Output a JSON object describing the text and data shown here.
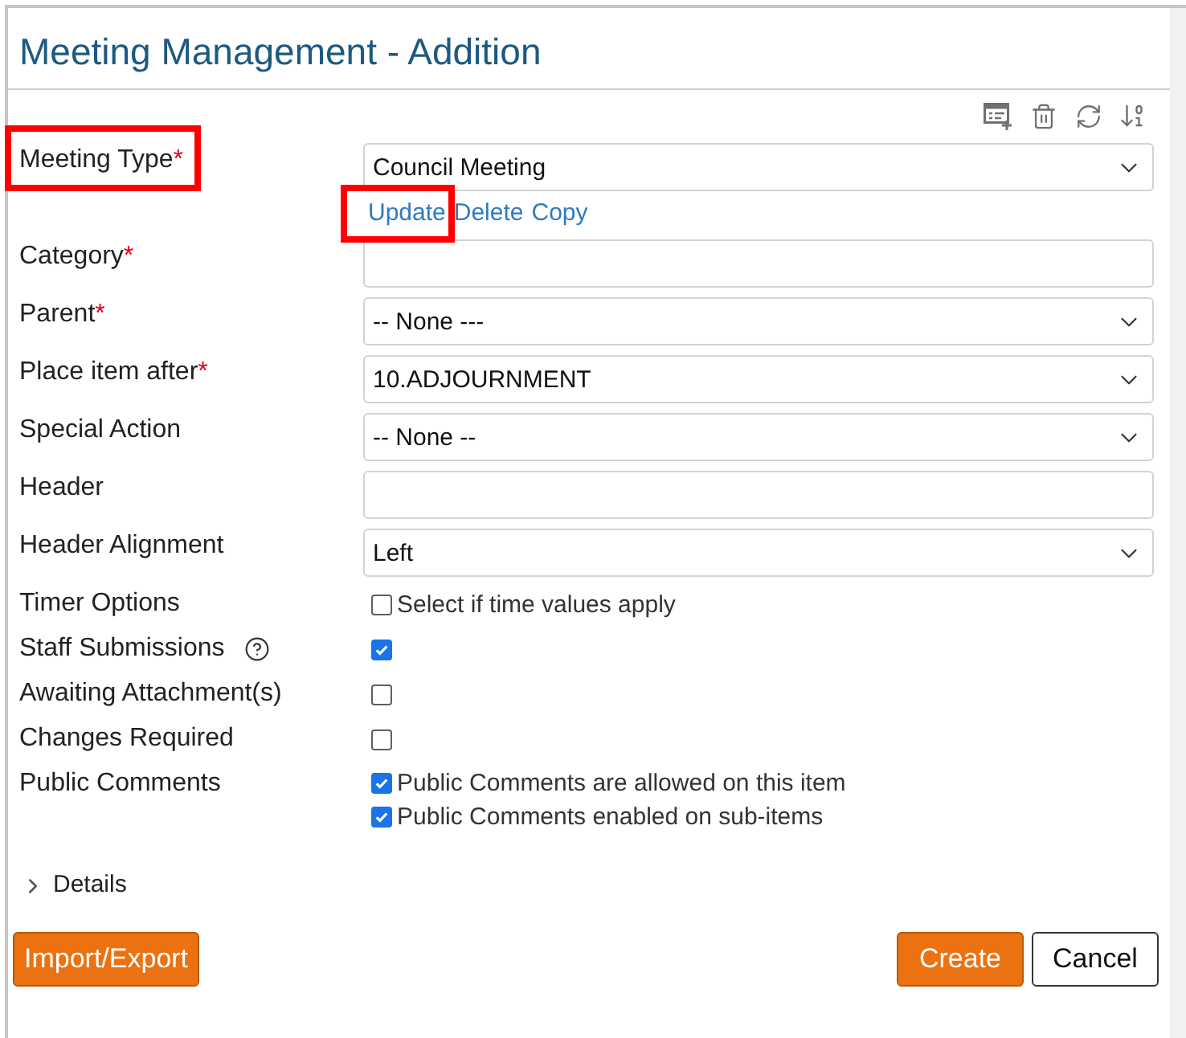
{
  "title": "Meeting Management - Addition",
  "fields": [
    {
      "kind": "select",
      "label": "Meeting Type",
      "required_mark": "*",
      "help": false,
      "highlighted": true,
      "value": "Council Meeting",
      "links": [
        {
          "label": "Update",
          "highlighted": true
        },
        {
          "label": "Delete",
          "highlighted": false
        },
        {
          "label": "Copy",
          "highlighted": false
        }
      ]
    },
    {
      "kind": "text",
      "label": "Category",
      "required_mark": "*",
      "help": false,
      "highlighted": false
    },
    {
      "kind": "select",
      "label": "Parent",
      "required_mark": "*",
      "help": false,
      "highlighted": false,
      "value": "-- None ---"
    },
    {
      "kind": "select",
      "label": "Place item after",
      "required_mark": "*",
      "help": false,
      "highlighted": false,
      "value": "10.ADJOURNMENT"
    },
    {
      "kind": "select",
      "label": "Special Action",
      "help": false,
      "highlighted": false,
      "value": "-- None --"
    },
    {
      "kind": "text",
      "label": "Header",
      "help": false,
      "highlighted": false
    },
    {
      "kind": "select",
      "label": "Header Alignment",
      "help": false,
      "highlighted": false,
      "value": "Left"
    },
    {
      "kind": "checkboxes",
      "label": "Timer Options",
      "help": false,
      "highlighted": false,
      "options": [
        {
          "label": "Select if time values apply",
          "checked": false
        }
      ]
    },
    {
      "kind": "checkboxes",
      "label": "Staff Submissions",
      "help": true,
      "highlighted": false,
      "options": [
        {
          "checked": true
        }
      ]
    },
    {
      "kind": "checkboxes",
      "label": "Awaiting Attachment(s)",
      "help": false,
      "highlighted": false,
      "options": [
        {
          "checked": false
        }
      ]
    },
    {
      "kind": "checkboxes",
      "label": "Changes Required",
      "help": false,
      "highlighted": false,
      "options": [
        {
          "checked": false
        }
      ]
    },
    {
      "kind": "checkboxes",
      "label": "Public Comments",
      "help": false,
      "highlighted": false,
      "options": [
        {
          "label": "Public Comments are allowed on this item",
          "checked": true
        },
        {
          "label": "Public Comments enabled on sub-items",
          "checked": true
        }
      ]
    }
  ],
  "details": {
    "label": "Details",
    "expanded": false
  },
  "footer": {
    "left_buttons": [
      {
        "label": "Import/Export",
        "kind": "primary"
      }
    ],
    "right_buttons": [
      {
        "label": "Create",
        "kind": "primary"
      },
      {
        "label": "Cancel",
        "kind": "secondary"
      }
    ]
  }
}
